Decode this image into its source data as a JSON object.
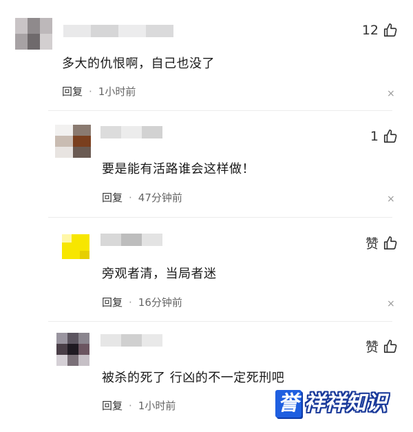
{
  "comments": [
    {
      "likes": "12",
      "text": "多大的仇恨啊，自己也没了",
      "reply_label": "回复",
      "time": "1小时前"
    },
    {
      "likes": "1",
      "text": "要是能有活路谁会这样做！",
      "reply_label": "回复",
      "time": "47分钟前"
    },
    {
      "likes": "赞",
      "text": "旁观者清，当局者迷",
      "reply_label": "回复",
      "time": "16分钟前"
    },
    {
      "likes": "赞",
      "text": "被杀的死了 行凶的不一定死刑吧",
      "reply_label": "回复",
      "time": "1小时前"
    }
  ],
  "close_glyph": "×",
  "watermark": {
    "badge": "誉",
    "text": "祥祥知识"
  },
  "colors": {
    "accent_blue": "#1f5fe0",
    "meta_gray": "#666666",
    "text": "#1a1a1a"
  }
}
